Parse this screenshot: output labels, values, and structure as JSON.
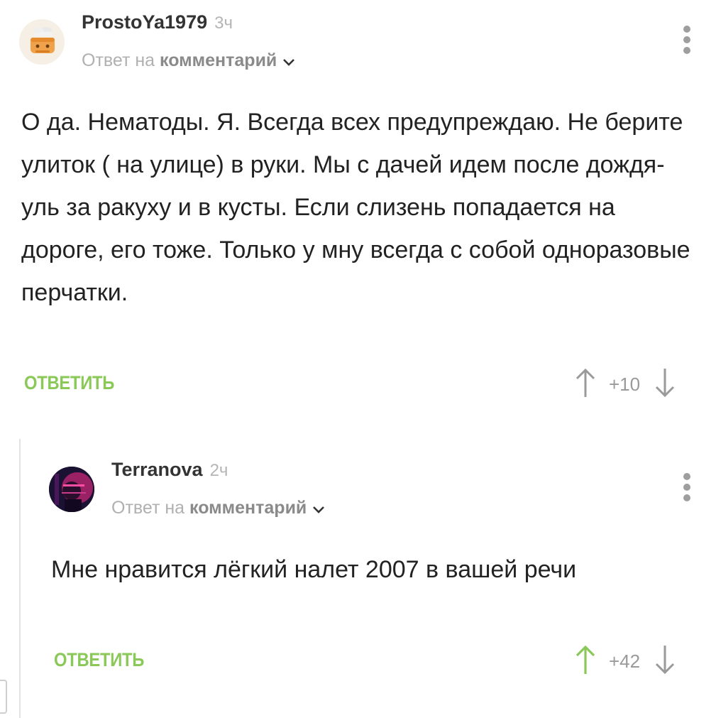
{
  "comments": [
    {
      "author": "ProstoYa1979",
      "time": "3ч",
      "reply_prefix": "Ответ на",
      "reply_link": "комментарий",
      "text": "О да. Нематоды. Я. Всегда всех предупреждаю. Не берите улиток ( на улице) в руки. Мы с дачей идем после дождя- уль за ракуху и в кусты. Если слизень попадается на дороге, его тоже. Только у мну всегда с собой одноразовые перчатки.",
      "reply_label": "ОТВЕТИТЬ",
      "score": "+10",
      "upvoted": false
    },
    {
      "author": "Terranova",
      "time": "2ч",
      "reply_prefix": "Ответ на",
      "reply_link": "комментарий",
      "text": "Мне нравится лёгкий налет 2007 в вашей речи",
      "reply_label": "ОТВЕТИТЬ",
      "score": "+42",
      "upvoted": true
    }
  ],
  "colors": {
    "accent_green": "#8ac858",
    "vote_gray": "#9a9a9a"
  },
  "icons": [
    "avatar-cook",
    "avatar-neon",
    "more-vert-icon",
    "chevron-down-icon",
    "arrow-up-icon",
    "arrow-down-icon"
  ]
}
